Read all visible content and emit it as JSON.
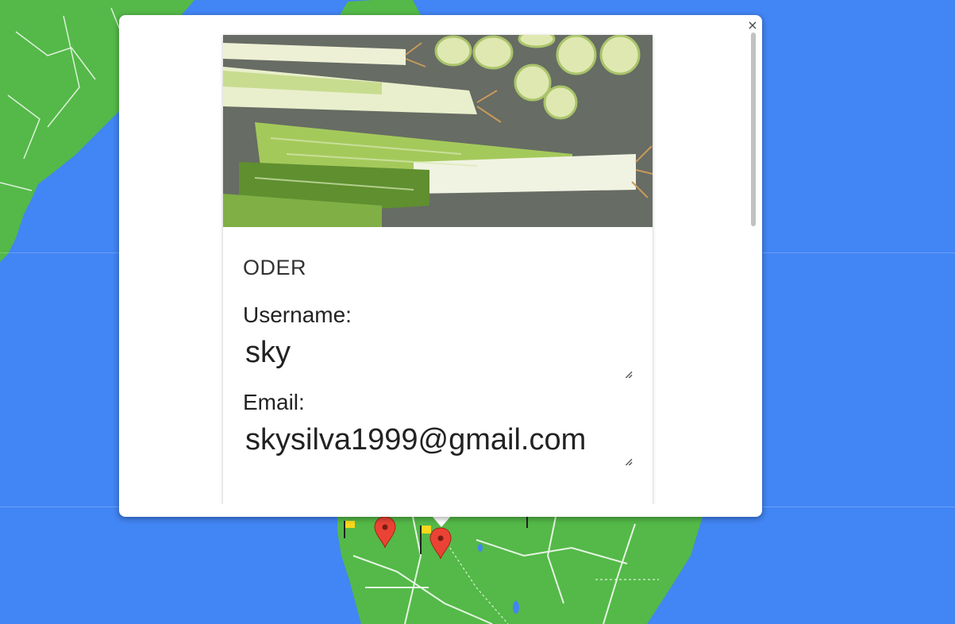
{
  "dialog": {
    "close_label": "×",
    "title": "ODER",
    "image_alt": "leeks"
  },
  "form": {
    "username_label": "Username:",
    "username_value": "sky",
    "email_label": "Email:",
    "email_value": "skysilva1999@gmail.com"
  },
  "map": {
    "water_color": "#4285f4",
    "land_color": "#54b948",
    "marker_color": "#ea4335",
    "markers": [
      "map-marker",
      "map-marker"
    ]
  }
}
